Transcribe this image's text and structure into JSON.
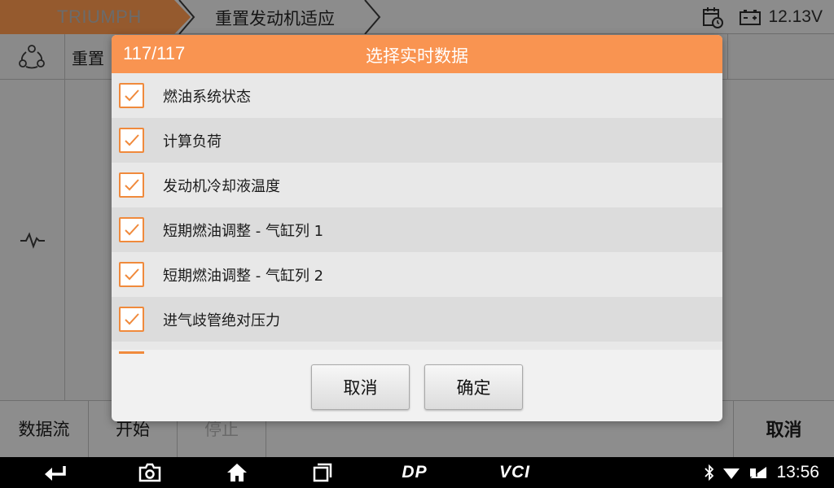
{
  "header": {
    "brand": "TRIUMPH",
    "page_title": "重置发动机适应",
    "voltage": "12.13V"
  },
  "subheader": {
    "label": "重置"
  },
  "bottom_bar": {
    "data_stream": "数据流",
    "start": "开始",
    "stop": "停止",
    "cancel": "取消"
  },
  "dialog": {
    "counter": "117/117",
    "title": "选择实时数据",
    "items": [
      {
        "label": "燃油系统状态",
        "checked": true
      },
      {
        "label": "计算负荷",
        "checked": true
      },
      {
        "label": "发动机冷却液温度",
        "checked": true
      },
      {
        "label": "短期燃油调整 - 气缸列 1",
        "checked": true
      },
      {
        "label": "短期燃油调整 - 气缸列 2",
        "checked": true
      },
      {
        "label": "进气歧管绝对压力",
        "checked": true
      }
    ],
    "cancel_button": "取消",
    "confirm_button": "确定"
  },
  "navbar": {
    "dp_label": "DP",
    "vci_label": "VCI",
    "time": "13:56"
  },
  "colors": {
    "accent": "#f99451",
    "checkbox_border": "#f08a3c",
    "brand_tab": "#955a2e"
  }
}
